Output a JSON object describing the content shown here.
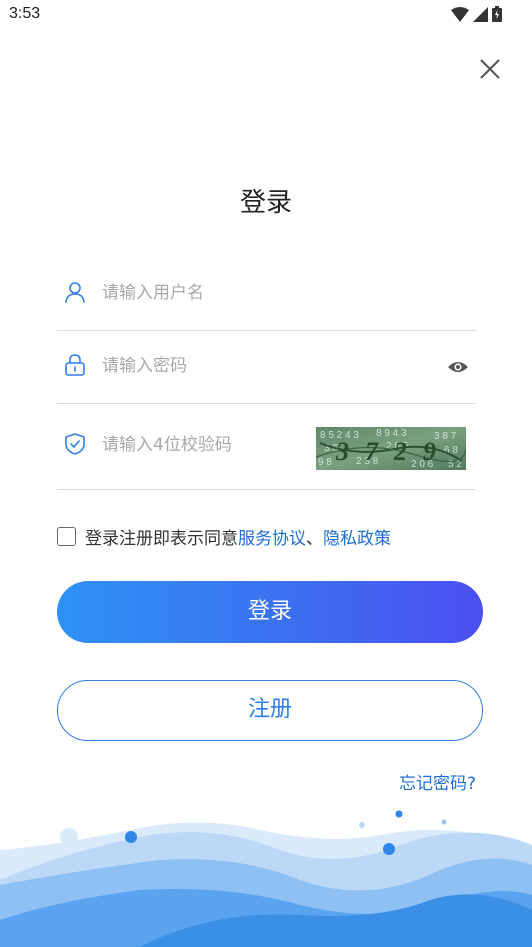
{
  "status_bar": {
    "time": "3:53"
  },
  "page": {
    "title": "登录"
  },
  "form": {
    "username_placeholder": "请输入用户名",
    "password_placeholder": "请输入密码",
    "captcha_placeholder": "请输入4位校验码",
    "captcha_text": "3729"
  },
  "agreement": {
    "prefix": "登录注册即表示同意",
    "service_link": "服务协议",
    "separator": "、",
    "privacy_link": "隐私政策"
  },
  "buttons": {
    "login": "登录",
    "register": "注册",
    "forgot": "忘记密码?"
  },
  "colors": {
    "accent": "#2f7fe8",
    "gradient_start": "#2e93f5",
    "gradient_end": "#4c4ff0",
    "link": "#1f6fd6"
  },
  "icons": [
    "wifi-icon",
    "signal-icon",
    "battery-icon",
    "close-icon",
    "user-icon",
    "lock-icon",
    "eye-icon",
    "shield-icon"
  ]
}
